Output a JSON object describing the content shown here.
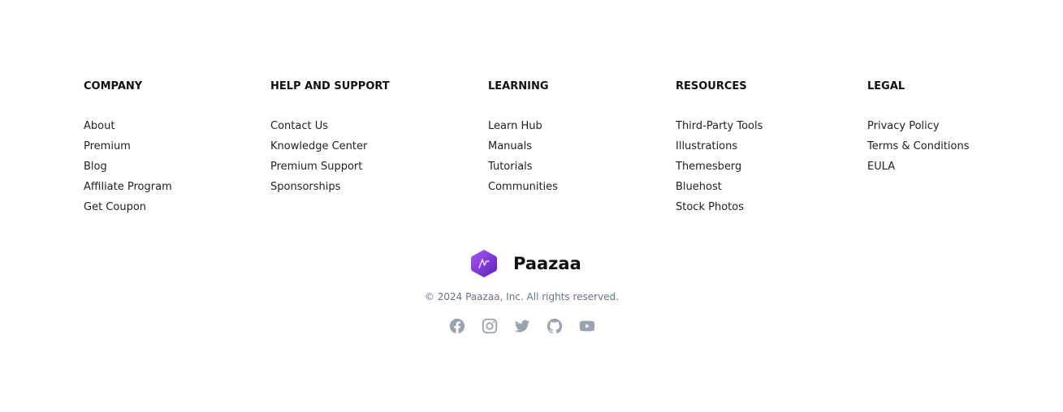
{
  "columns": [
    {
      "heading": "COMPANY",
      "links": [
        "About",
        "Premium",
        "Blog",
        "Affiliate Program",
        "Get Coupon"
      ]
    },
    {
      "heading": "HELP AND SUPPORT",
      "links": [
        "Contact Us",
        "Knowledge Center",
        "Premium Support",
        "Sponsorships"
      ]
    },
    {
      "heading": "LEARNING",
      "links": [
        "Learn Hub",
        "Manuals",
        "Tutorials",
        "Communities"
      ]
    },
    {
      "heading": "RESOURCES",
      "links": [
        "Third-Party Tools",
        "Illustrations",
        "Themesberg",
        "Bluehost",
        "Stock Photos"
      ]
    },
    {
      "heading": "LEGAL",
      "links": [
        "Privacy Policy",
        "Terms & Conditions",
        "EULA"
      ]
    }
  ],
  "brand": {
    "name": "Paazaa",
    "logo_icon": "hexagon-logo-icon",
    "logo_color": "#7c3aed"
  },
  "copyright": "© 2024 Paazaa, Inc. All rights reserved.",
  "socials": [
    {
      "icon": "facebook-icon"
    },
    {
      "icon": "instagram-icon"
    },
    {
      "icon": "twitter-icon"
    },
    {
      "icon": "github-icon"
    },
    {
      "icon": "youtube-icon"
    }
  ],
  "colors": {
    "social_icon": "#9ca3af",
    "text": "#111111",
    "muted": "#6b7280"
  }
}
